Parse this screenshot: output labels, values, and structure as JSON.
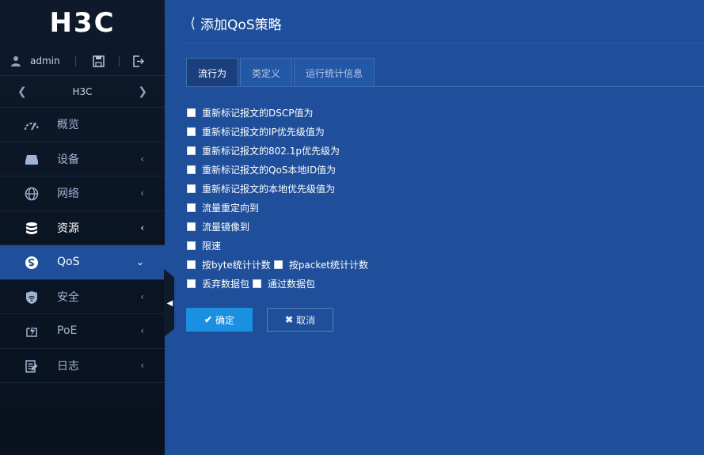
{
  "sidebar": {
    "logo": "H3C",
    "user": {
      "name": "admin"
    },
    "device": {
      "name": "H3C"
    },
    "menu": [
      {
        "label": "概览",
        "icon": "gauge-icon",
        "chevron": ""
      },
      {
        "label": "设备",
        "icon": "device-icon",
        "chevron": "‹"
      },
      {
        "label": "网络",
        "icon": "globe-icon",
        "chevron": "‹"
      },
      {
        "label": "资源",
        "icon": "database-icon",
        "chevron": "‹"
      },
      {
        "label": "QoS",
        "icon": "qos-icon",
        "chevron": "⌄"
      },
      {
        "label": "安全",
        "icon": "shield-icon",
        "chevron": "‹"
      },
      {
        "label": "PoE",
        "icon": "power-icon",
        "chevron": "‹"
      },
      {
        "label": "日志",
        "icon": "log-icon",
        "chevron": "‹"
      }
    ]
  },
  "main": {
    "title": "添加QoS策略",
    "tabs": [
      "流行为",
      "类定义",
      "运行统计信息"
    ],
    "options": [
      "重新标记报文的DSCP值为",
      "重新标记报文的IP优先级值为",
      "重新标记报文的802.1p优先级为",
      "重新标记报文的QoS本地ID值为",
      "重新标记报文的本地优先级值为",
      "流量重定向到",
      "流量镜像到",
      "限速"
    ],
    "pair_rows": [
      {
        "a": "按byte统计计数",
        "b": "按packet统计计数"
      },
      {
        "a": "丢弃数据包",
        "b": "通过数据包"
      }
    ],
    "ok_label": "确定",
    "cancel_label": "取消"
  },
  "colors": {
    "accent": "#1b8fe0",
    "main_bg": "#1f4f9a",
    "sidebar_bg": "#0e1a2c"
  }
}
